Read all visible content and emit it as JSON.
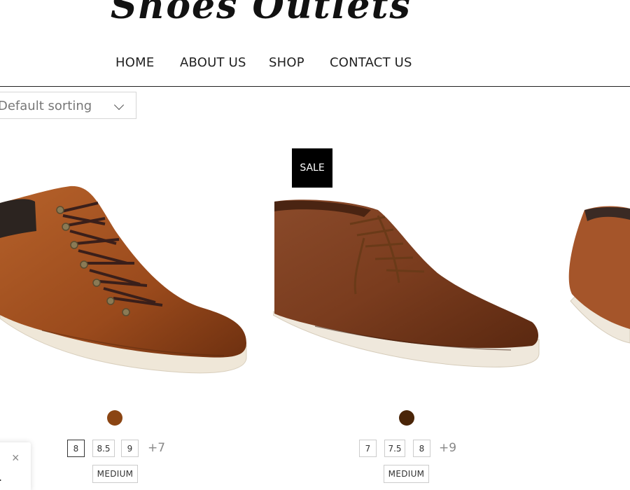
{
  "site": {
    "title": "Shoes Outlets"
  },
  "nav": {
    "items": [
      "HOME",
      "ABOUT US",
      "SHOP",
      "CONTACT US"
    ]
  },
  "sorting": {
    "selected": "Default sorting"
  },
  "products": [
    {
      "badge": "",
      "swatch_color": "#8B4513",
      "sizes": [
        "8",
        "8.5",
        "9"
      ],
      "more_sizes": "+7",
      "width": "MEDIUM"
    },
    {
      "badge": "SALE",
      "swatch_color": "#4A2508",
      "sizes": [
        "7",
        "7.5",
        "8"
      ],
      "more_sizes": "+9",
      "width": "MEDIUM"
    }
  ],
  "popup": {
    "close_icon": "×",
    "text": "."
  },
  "icons": [
    "chevron-down-icon",
    "close-icon"
  ]
}
